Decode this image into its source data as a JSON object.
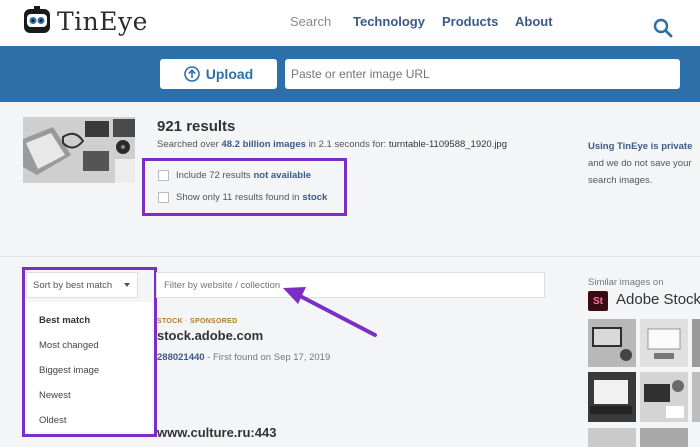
{
  "header": {
    "logo_text": "TinEye",
    "nav": {
      "search": "Search",
      "technology": "Technology",
      "products": "Products",
      "about": "About"
    }
  },
  "searchbar": {
    "upload_label": "Upload",
    "url_placeholder": "Paste or enter image URL"
  },
  "results": {
    "count": "921 results",
    "searched_prefix": "Searched over",
    "searched_images": "48.2 billion images",
    "searched_mid": "in 2.1 seconds for:",
    "filename": "turntable-1109588_1920.jpg"
  },
  "options": {
    "include_prefix": "Include 72 results",
    "include_em": "not available",
    "stock_prefix": "Show only 11 results found in",
    "stock_em": "stock"
  },
  "side_note": {
    "link": "Using TinEye is private",
    "line2": "and we do not save your",
    "line3": "search images."
  },
  "sort": {
    "selected": "Sort by best match",
    "options": [
      "Best match",
      "Most changed",
      "Biggest image",
      "Newest",
      "Oldest"
    ]
  },
  "filter": {
    "placeholder": "Filter by website / collection"
  },
  "result_items": [
    {
      "tag": "STOCK",
      "tag2": "SPONSORED",
      "domain": "stock.adobe.com",
      "id": "288021440",
      "meta": " - First found on Sep 17, 2019"
    },
    {
      "domain": "www.culture.ru:443"
    }
  ],
  "similar": {
    "title": "Similar images on",
    "brand": "Adobe Stock",
    "brand_logo": "St"
  },
  "colors": {
    "brand_blue": "#2d6fa8",
    "link_blue": "#3c5a86",
    "highlight_purple": "#7b2ec4"
  }
}
